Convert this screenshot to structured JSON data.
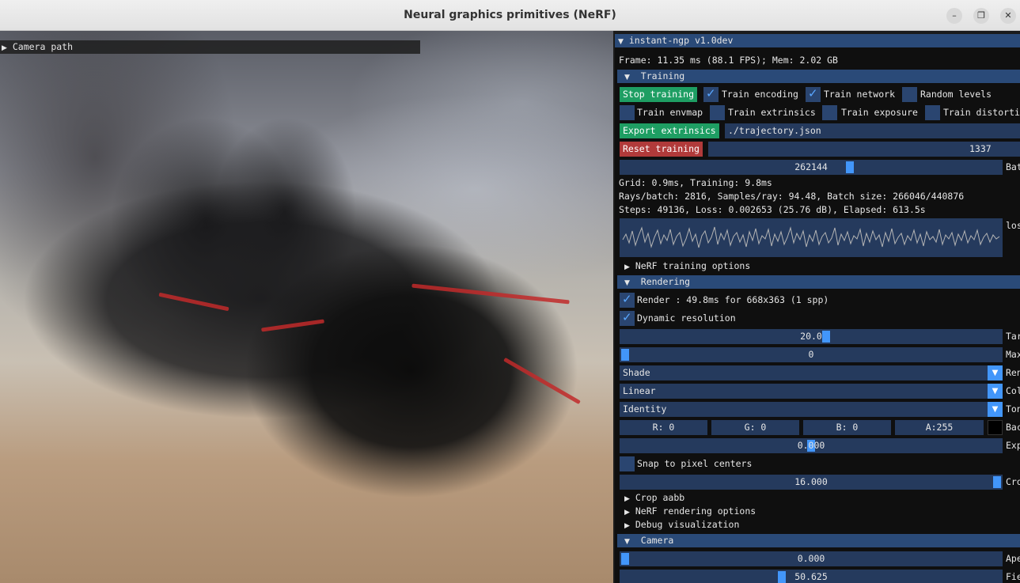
{
  "window": {
    "title": "Neural graphics primitives (NeRF)",
    "minimize": "–",
    "maximize": "❐",
    "close": "✕"
  },
  "viewport": {
    "camera_path": "Camera path"
  },
  "panel": {
    "title": "instant-ngp v1.0dev",
    "frame_info": "Frame: 11.35 ms (88.1 FPS); Mem: 2.02 GB",
    "training": {
      "header": "Training",
      "stop_training": "Stop training",
      "train_encoding": "Train encoding",
      "train_encoding_checked": true,
      "train_network": "Train network",
      "train_network_checked": true,
      "random_levels": "Random levels",
      "random_levels_checked": false,
      "train_envmap": "Train envmap",
      "train_extrinsics": "Train extrinsics",
      "train_exposure": "Train exposure",
      "train_distortion": "Train distortion",
      "export_extrinsics": "Export extrinsics",
      "extrinsics_path": "./trajectory.json",
      "reset_training": "Reset training",
      "seed_value": "1337",
      "batch_value": "262144",
      "batch_label": "Bat",
      "grid_time": "Grid: 0.9ms, Training: 9.8ms",
      "rays_info": "Rays/batch: 2816, Samples/ray: 94.48, Batch size: 266046/440876",
      "steps_info": "Steps: 49136, Loss: 0.002653 (25.76 dB), Elapsed: 613.5s",
      "loss_label": "los",
      "nerf_training_options": "NeRF training options"
    },
    "rendering": {
      "header": "Rendering",
      "render_label": "Render : 49.8ms for 668x363 (1 spp)",
      "render_checked": true,
      "dynamic_resolution": "Dynamic resolution",
      "dynamic_checked": true,
      "target_fps": "20.0",
      "target_label": "Tar",
      "max_spp": "0",
      "max_label": "Max",
      "render_mode": "Shade",
      "render_mode_label": "Ren",
      "color_space": "Linear",
      "color_space_label": "Col",
      "tonemap": "Identity",
      "tonemap_label": "Ton",
      "bg_r": "R:  0",
      "bg_g": "G:  0",
      "bg_b": "B:  0",
      "bg_a": "A:255",
      "bg_label": "Bac",
      "exposure": "0.000",
      "exposure_label": "Exp",
      "snap_pixel": "Snap to pixel centers",
      "crop": "16.000",
      "crop_label": "Cro",
      "crop_aabb": "Crop aabb",
      "nerf_rendering_options": "NeRF rendering options",
      "debug_visualization": "Debug visualization"
    },
    "camera": {
      "header": "Camera",
      "aperture": "0.000",
      "aperture_label": "Ape",
      "fov": "50.625",
      "fov_label": "Fie"
    }
  },
  "colors": {
    "header": "#2a4a78",
    "widget": "#253a5d",
    "accent": "#4296fa",
    "green": "#1e9e63",
    "red": "#b13a3a"
  }
}
